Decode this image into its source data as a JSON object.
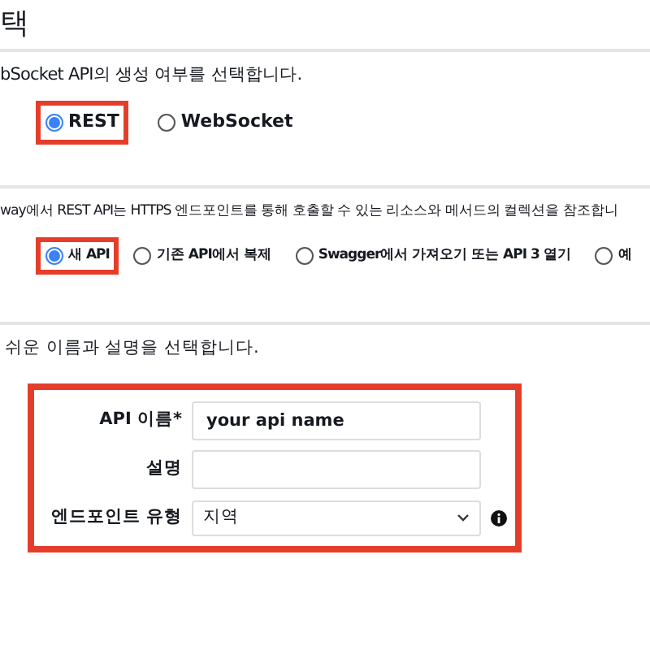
{
  "heading": "택",
  "sections": [
    {
      "description": "bSocket API의 생성 여부를 선택합니다.",
      "options": [
        {
          "label": "REST",
          "selected": true,
          "highlighted": true
        },
        {
          "label": "WebSocket",
          "selected": false,
          "highlighted": false
        }
      ]
    },
    {
      "description": "way에서 REST API는 HTTPS 엔드포인트를 통해 호출할 수 있는 리소스와 메서드의 컬렉션을 참조합니",
      "options": [
        {
          "label": "새 API",
          "selected": true,
          "highlighted": true
        },
        {
          "label": "기존 API에서 복제",
          "selected": false,
          "highlighted": false
        },
        {
          "label": "Swagger에서 가져오기 또는 API 3 열기",
          "selected": false,
          "highlighted": false
        },
        {
          "label": "예",
          "selected": false,
          "highlighted": false
        }
      ]
    }
  ],
  "settings": {
    "description": "쉬운 이름과 설명을 선택합니다.",
    "highlighted": true,
    "fields": [
      {
        "kind": "text",
        "label": "API 이름*",
        "value": "your api name"
      },
      {
        "kind": "text",
        "label": "설명"
      },
      {
        "kind": "select",
        "label": "엔드포인트 유형",
        "value": "지역",
        "info": true
      }
    ]
  }
}
